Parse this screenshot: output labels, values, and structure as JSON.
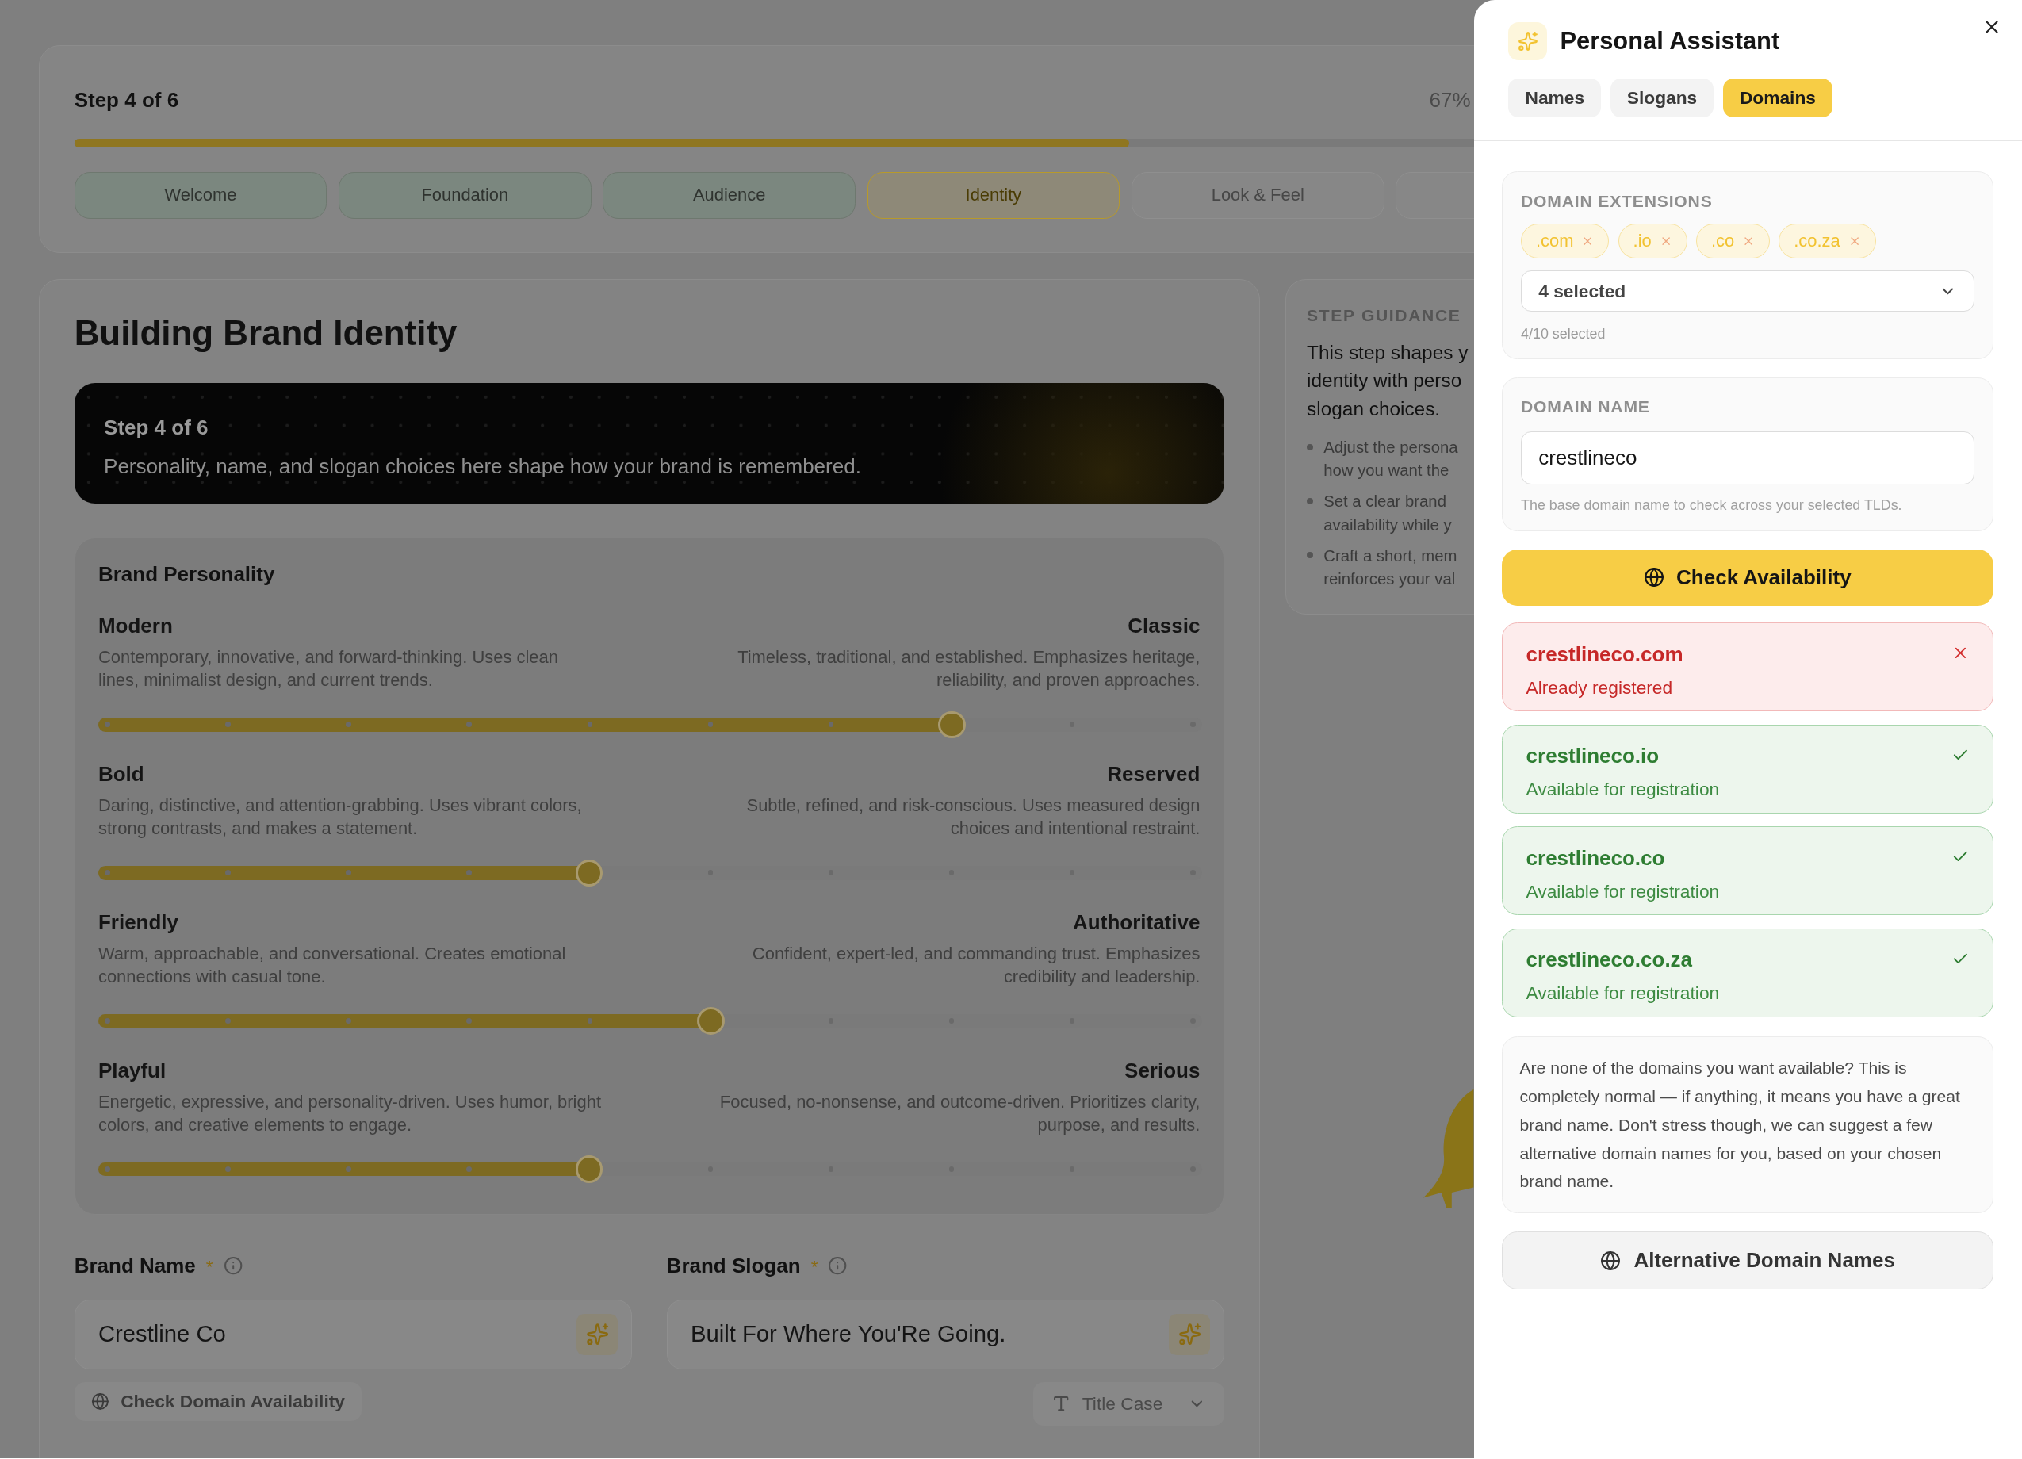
{
  "progress": {
    "title": "Step 4 of 6",
    "percent": "67%",
    "level": 0.67
  },
  "steps": [
    {
      "label": "Welcome",
      "completed": true,
      "selected": false
    },
    {
      "label": "Foundation",
      "completed": true,
      "selected": false
    },
    {
      "label": "Audience",
      "completed": true,
      "selected": false
    },
    {
      "label": "Identity",
      "completed": false,
      "selected": true
    },
    {
      "label": "Look & Feel",
      "completed": false,
      "selected": false
    },
    {
      "completed": false,
      "selected": false
    }
  ],
  "page": {
    "title": "Building Brand Identity"
  },
  "banner": {
    "eyebrow": "Step 4 of 6",
    "text": "Personality, name, and slogan choices here shape how your brand is remembered."
  },
  "personality": {
    "title": "Brand Personality",
    "traits": [
      {
        "left": "Modern",
        "left_description": "Contemporary, innovative, and forward-thinking. Uses clean lines, minimalist design, and current trends.",
        "right": "Classic",
        "right_description": "Timeless, traditional, and established. Emphasizes heritage, reliability, and proven approaches.",
        "level": 0.778
      },
      {
        "left": "Bold",
        "left_description": "Daring, distinctive, and attention-grabbing. Uses vibrant colors, strong contrasts, and makes a statement.",
        "right": "Reserved",
        "right_description": "Subtle, refined, and risk-conscious. Uses measured design choices and intentional restraint.",
        "level": 0.444
      },
      {
        "left": "Friendly",
        "left_description": "Warm, approachable, and conversational. Creates emotional connections with casual tone.",
        "right": "Authoritative",
        "right_description": "Confident, expert-led, and commanding trust. Emphasizes credibility and leadership.",
        "level": 0.556
      },
      {
        "left": "Playful",
        "left_description": "Energetic, expressive, and personality-driven. Uses humor, bright colors, and creative elements to engage.",
        "right": "Serious",
        "right_description": "Focused, no-nonsense, and outcome-driven. Prioritizes clarity, purpose, and results.",
        "level": 0.444
      }
    ]
  },
  "brand_name": {
    "label": "Brand Name",
    "required_mark": "*",
    "value": "Crestline Co",
    "action": "Check Domain Availability"
  },
  "brand_slogan": {
    "label": "Brand Slogan",
    "required_mark": "*",
    "value": "Built For Where You'Re Going.",
    "case_select": "Title Case"
  },
  "guidance": {
    "title": "STEP GUIDANCE",
    "lines": [
      "This step shapes y",
      "identity with perso",
      "slogan choices."
    ],
    "bullets": [
      [
        "Adjust the persona",
        "how you want the"
      ],
      [
        "Set a clear brand",
        "availability while y"
      ],
      [
        "Craft a short, mem",
        "reinforces your val"
      ]
    ]
  },
  "assistant": {
    "title": "Personal Assistant",
    "tabs": [
      {
        "label": "Names",
        "selected": false
      },
      {
        "label": "Slogans",
        "selected": false
      },
      {
        "label": "Domains",
        "selected": true
      }
    ],
    "extensions": {
      "label": "DOMAIN EXTENSIONS",
      "chips": [
        ".com",
        ".io",
        ".co",
        ".co.za"
      ],
      "select": "4 selected",
      "count": "4/10 selected"
    },
    "domain_name": {
      "label": "DOMAIN NAME",
      "value": "crestlineco",
      "help": "The base domain name to check across your selected TLDs."
    },
    "check_button": "Check Availability",
    "results": [
      {
        "domain": "crestlineco.com",
        "status": "Already registered",
        "kind": "taken"
      },
      {
        "domain": "crestlineco.io",
        "status": "Available for registration",
        "kind": "available"
      },
      {
        "domain": "crestlineco.co",
        "status": "Available for registration",
        "kind": "available"
      },
      {
        "domain": "crestlineco.co.za",
        "status": "Available for registration",
        "kind": "available"
      }
    ],
    "note": "Are none of the domains you want available? This is completely normal — if anything, it means you have a great brand name. Don't stress though, we can suggest a few alternative domain names for you, based on your chosen brand name.",
    "alt_button": "Alternative Domain Names"
  }
}
